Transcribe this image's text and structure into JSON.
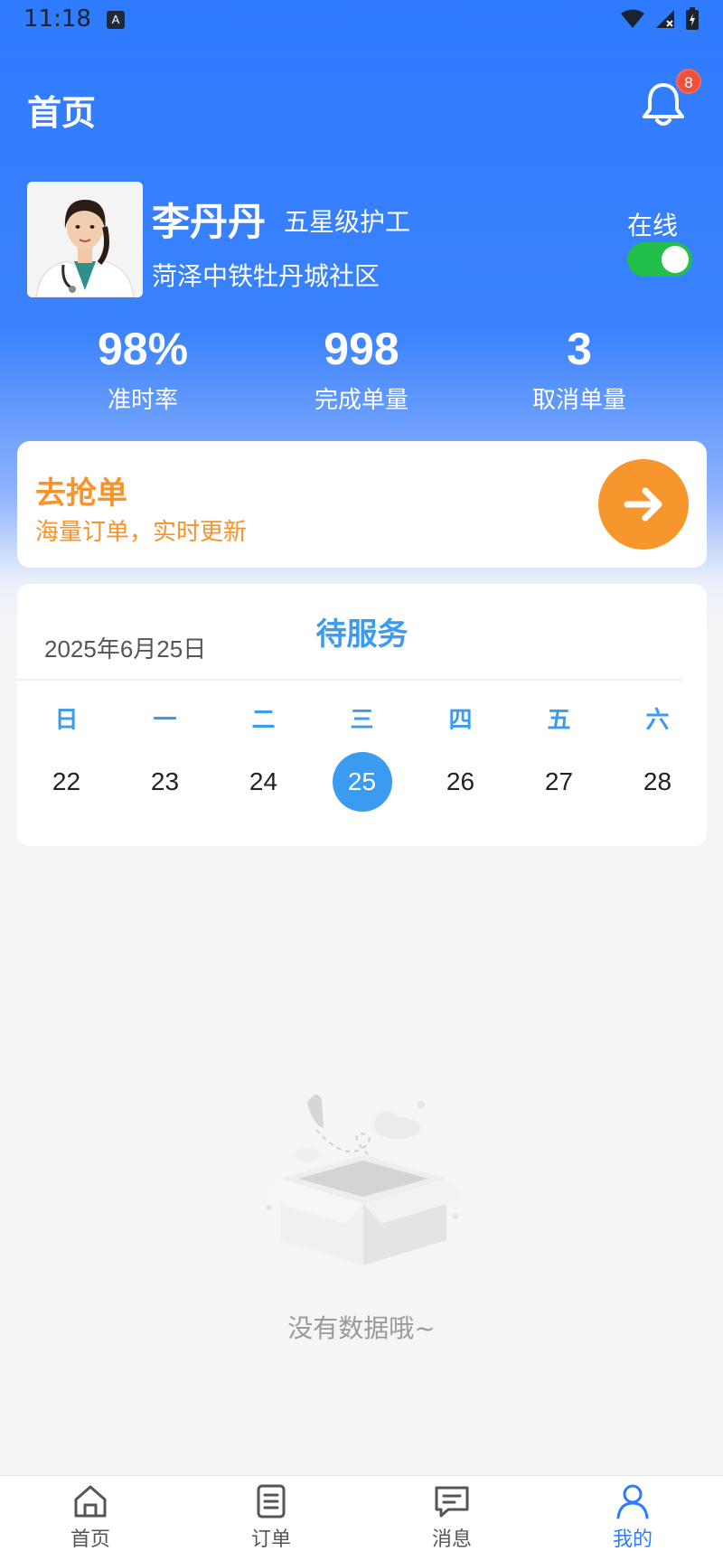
{
  "status_bar": {
    "time": "11:18",
    "notification_icon_letter": "A"
  },
  "header": {
    "title": "首页",
    "notification_badge": "8"
  },
  "profile": {
    "name": "李丹丹",
    "level": "五星级护工",
    "community": "菏泽中铁牡丹城社区",
    "online_label": "在线",
    "online": true
  },
  "stats": [
    {
      "value": "98%",
      "label": "准时率"
    },
    {
      "value": "998",
      "label": "完成单量"
    },
    {
      "value": "3",
      "label": "取消单量"
    }
  ],
  "grab_card": {
    "title": "去抢单",
    "subtitle": "海量订单，实时更新"
  },
  "calendar": {
    "date": "2025年6月25日",
    "title": "待服务",
    "weekdays": [
      "日",
      "一",
      "二",
      "三",
      "四",
      "五",
      "六"
    ],
    "days": [
      "22",
      "23",
      "24",
      "25",
      "26",
      "27",
      "28"
    ],
    "selected_day": "25"
  },
  "empty_state": {
    "text": "没有数据哦~"
  },
  "tabs": [
    {
      "label": "首页",
      "icon": "home-icon",
      "active": false
    },
    {
      "label": "订单",
      "icon": "orders-icon",
      "active": false
    },
    {
      "label": "消息",
      "icon": "message-icon",
      "active": false
    },
    {
      "label": "我的",
      "icon": "profile-icon",
      "active": true
    }
  ],
  "colors": {
    "primary": "#2f7bff",
    "accent_orange": "#f8962e",
    "calendar_blue": "#3a9bf0",
    "toggle_green": "#22c04a"
  }
}
